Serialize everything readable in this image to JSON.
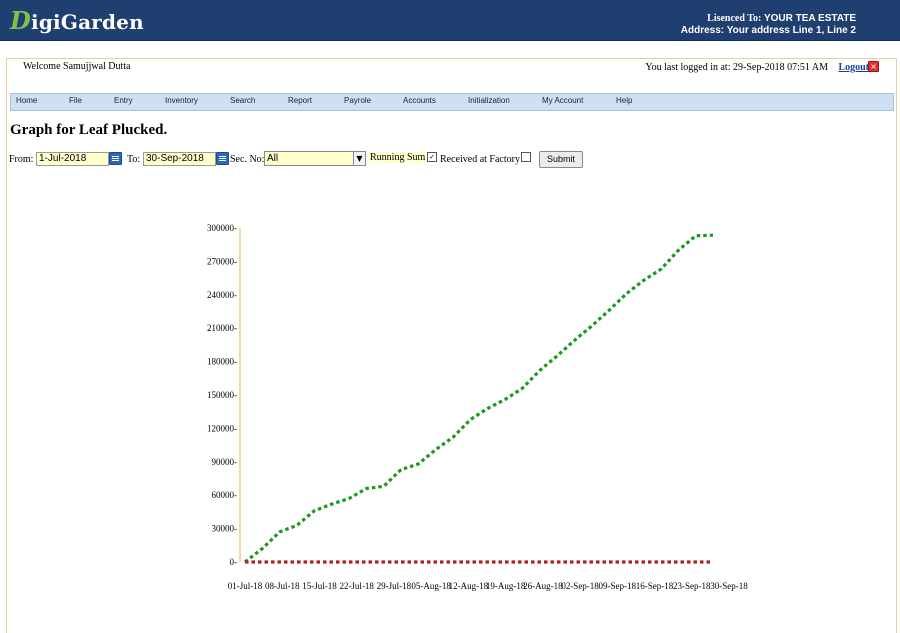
{
  "header": {
    "logo_initial": "D",
    "logo_rest": "igiGarden",
    "licensed_label": "Lisenced To:",
    "licensed_value": "YOUR TEA ESTATE",
    "address": "Address: Your address Line 1, Line 2"
  },
  "user_bar": {
    "welcome": "Welcome Samujjwal Dutta",
    "last_login": "You last logged in at: 29-Sep-2018 07:51 AM",
    "logout": "Logout"
  },
  "menu": [
    "Home",
    "File",
    "Entry",
    "Inventory",
    "Search",
    "Report",
    "Payrole",
    "Accounts",
    "Initialization",
    "My Account",
    "Help"
  ],
  "page_title": "Graph for Leaf Plucked.",
  "filters": {
    "from_label": "From:",
    "from_value": "1-Jul-2018",
    "to_label": "To:",
    "to_value": "30-Sep-2018",
    "sec_label": "Sec. No:",
    "sec_value": "All",
    "running_sum_label": "Running Sum",
    "running_sum_checked": true,
    "received_label": "Received at Factory",
    "received_checked": false,
    "submit_label": "Submit"
  },
  "colors": {
    "series_green": "#1a9a1a",
    "series_red": "#b02020",
    "axis": "#f0c890"
  },
  "chart_data": {
    "type": "line",
    "ylim": [
      0,
      300000
    ],
    "yticks": [
      "300000-",
      "270000-",
      "240000-",
      "210000-",
      "180000-",
      "150000-",
      "120000-",
      "90000-",
      "60000-",
      "30000-",
      "0-"
    ],
    "ytick_values": [
      300000,
      270000,
      240000,
      210000,
      180000,
      150000,
      120000,
      90000,
      60000,
      30000,
      0
    ],
    "xticks": [
      "01-Jul-18",
      "08-Jul-18",
      "15-Jul-18",
      "22-Jul-18",
      "29-Jul-18",
      "05-Aug-18",
      "12-Aug-18",
      "19-Aug-18",
      "26-Aug-18",
      "02-Sep-18",
      "09-Sep-18",
      "16-Sep-18",
      "23-Sep-18",
      "30-Sep-18"
    ],
    "x_dates": [
      "2018-07-01",
      "2018-07-08",
      "2018-07-15",
      "2018-07-22",
      "2018-07-29",
      "2018-08-05",
      "2018-08-12",
      "2018-08-19",
      "2018-08-26",
      "2018-09-02",
      "2018-09-09",
      "2018-09-16",
      "2018-09-23",
      "2018-09-30"
    ],
    "series": [
      {
        "color": "#1a9a1a",
        "values": [
          0,
          12000,
          27000,
          33000,
          46000,
          52000,
          57000,
          66000,
          68000,
          83000,
          88000,
          101000,
          112000,
          128000,
          138000,
          146000,
          156000,
          172000,
          185000,
          199000,
          212000,
          226000,
          241000,
          253000,
          263000,
          280000,
          293000,
          293500
        ]
      },
      {
        "color": "#b02020",
        "values": [
          0,
          0,
          0,
          0,
          0,
          0,
          0,
          0,
          0,
          0,
          0,
          0,
          0,
          0,
          0,
          0,
          0,
          0,
          0,
          0,
          0,
          0,
          0,
          0,
          0,
          0,
          0,
          0
        ]
      }
    ],
    "series_end": "2018-09-27"
  }
}
